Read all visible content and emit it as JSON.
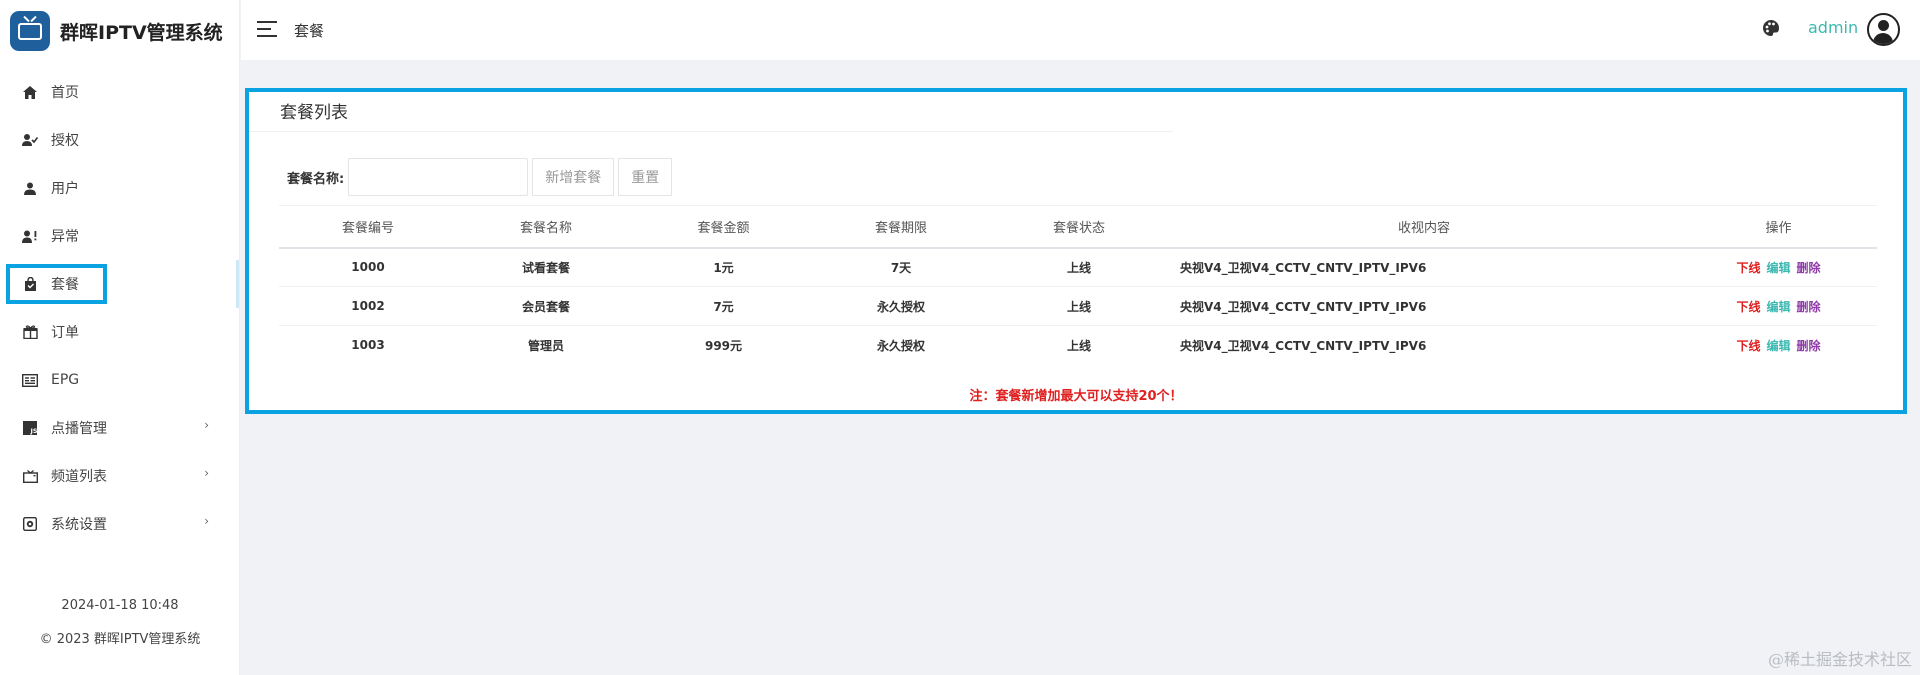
{
  "brand": {
    "title": "群晖IPTV管理系统"
  },
  "sidebar": {
    "items": [
      {
        "label": "首页",
        "icon": "home-icon"
      },
      {
        "label": "授权",
        "icon": "user-check-icon"
      },
      {
        "label": "用户",
        "icon": "user-icon"
      },
      {
        "label": "异常",
        "icon": "user-warning-icon"
      },
      {
        "label": "套餐",
        "icon": "bag-icon",
        "active": true
      },
      {
        "label": "订单",
        "icon": "gift-icon"
      },
      {
        "label": "EPG",
        "icon": "epg-icon"
      },
      {
        "label": "点播管理",
        "icon": "js-icon",
        "chevron": "›"
      },
      {
        "label": "频道列表",
        "icon": "tv-icon",
        "chevron": "›"
      },
      {
        "label": "系统设置",
        "icon": "settings-icon",
        "chevron": "›"
      }
    ],
    "footer": {
      "datetime": "2024-01-18 10:48",
      "copyright": "© 2023 群晖IPTV管理系统"
    }
  },
  "header": {
    "title": "套餐",
    "user": "admin"
  },
  "card": {
    "title": "套餐列表",
    "search": {
      "label": "套餐名称:",
      "value": "",
      "placeholder": ""
    },
    "buttons": {
      "add": "新增套餐",
      "reset": "重置"
    },
    "table": {
      "headers": [
        "套餐编号",
        "套餐名称",
        "套餐金额",
        "套餐期限",
        "套餐状态",
        "收视内容",
        "操作"
      ],
      "rows": [
        {
          "id": "1000",
          "name": "试看套餐",
          "price": "1元",
          "term": "7天",
          "status": "上线",
          "content": "央视V4_卫视V4_CCTV_CNTV_IPTV_IPV6",
          "ops": [
            "下线",
            "编辑",
            "删除"
          ]
        },
        {
          "id": "1002",
          "name": "会员套餐",
          "price": "7元",
          "term": "永久授权",
          "status": "上线",
          "content": "央视V4_卫视V4_CCTV_CNTV_IPTV_IPV6",
          "ops": [
            "下线",
            "编辑",
            "删除"
          ]
        },
        {
          "id": "1003",
          "name": "管理员",
          "price": "999元",
          "term": "永久授权",
          "status": "上线",
          "content": "央视V4_卫视V4_CCTV_CNTV_IPTV_IPV6",
          "ops": [
            "下线",
            "编辑",
            "删除"
          ]
        }
      ]
    },
    "note": "注：套餐新增加最大可以支持20个！"
  },
  "watermark": "@稀土掘金技术社区",
  "colors": {
    "accent": "#3cb8b0",
    "highlight_border": "#0aa2e0",
    "danger": "#e02020",
    "delete": "#8e3aa8"
  }
}
